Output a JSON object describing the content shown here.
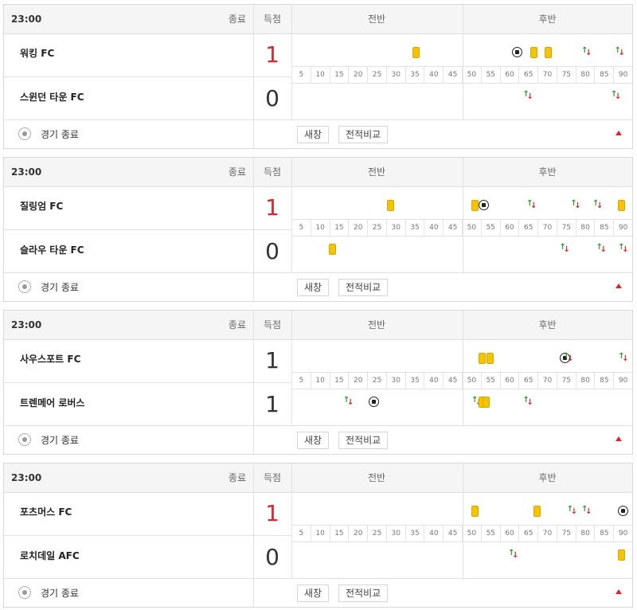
{
  "header": {
    "score_label": "득점",
    "first_half": "전반",
    "second_half": "후반"
  },
  "timeline_ticks": [
    "5",
    "10",
    "15",
    "20",
    "25",
    "30",
    "35",
    "40",
    "45",
    "50",
    "55",
    "60",
    "65",
    "70",
    "75",
    "80",
    "85",
    "90"
  ],
  "colors": {
    "win_score": "#d9262b",
    "yellow_card": "#f5c400",
    "sub_in": "#2a9d2a",
    "sub_out": "#d9262b"
  },
  "footer": {
    "status_text": "경기 종료",
    "refresh_label": "새창",
    "compare_label": "전적비교",
    "status_icon": "soccer-ball-icon"
  },
  "matches": [
    {
      "time": "23:00",
      "status": "종료",
      "home": {
        "name": "워킹 FC",
        "score": "1",
        "winner": true,
        "events": [
          {
            "type": "yellow",
            "minute": 34
          },
          {
            "type": "goal",
            "minute": 61
          },
          {
            "type": "yellow",
            "minute": 66
          },
          {
            "type": "yellow",
            "minute": 70
          },
          {
            "type": "sub",
            "minute": 80
          },
          {
            "type": "sub",
            "minute": 89
          }
        ]
      },
      "away": {
        "name": "스윈던 타운 FC",
        "score": "0",
        "winner": false,
        "events": [
          {
            "type": "sub",
            "minute": 64
          },
          {
            "type": "sub",
            "minute": 88
          }
        ]
      }
    },
    {
      "time": "23:00",
      "status": "종료",
      "home": {
        "name": "질링엄 FC",
        "score": "1",
        "winner": true,
        "events": [
          {
            "type": "yellow",
            "minute": 27
          },
          {
            "type": "yellow",
            "minute": 50
          },
          {
            "type": "goal",
            "minute": 52
          },
          {
            "type": "sub",
            "minute": 65
          },
          {
            "type": "sub",
            "minute": 77
          },
          {
            "type": "sub",
            "minute": 83
          },
          {
            "type": "yellow",
            "minute": 90
          }
        ]
      },
      "away": {
        "name": "슬라우 타운 FC",
        "score": "0",
        "winner": false,
        "events": [
          {
            "type": "yellow",
            "minute": 11
          },
          {
            "type": "sub",
            "minute": 74
          },
          {
            "type": "sub",
            "minute": 84
          },
          {
            "type": "sub",
            "minute": 90
          }
        ]
      }
    },
    {
      "time": "23:00",
      "status": "종료",
      "home": {
        "name": "사우스포트 FC",
        "score": "1",
        "winner": false,
        "events": [
          {
            "type": "yellow",
            "minute": 52
          },
          {
            "type": "yellow",
            "minute": 54
          },
          {
            "type": "goal",
            "minute": 74
          },
          {
            "type": "sub",
            "minute": 75
          },
          {
            "type": "sub",
            "minute": 90
          }
        ]
      },
      "away": {
        "name": "트렌메어 로버스",
        "score": "1",
        "winner": false,
        "events": [
          {
            "type": "sub",
            "minute": 15
          },
          {
            "type": "goal",
            "minute": 22
          },
          {
            "type": "sub",
            "minute": 50
          },
          {
            "type": "yellow",
            "minute": 52
          },
          {
            "type": "yellow",
            "minute": 53
          },
          {
            "type": "sub",
            "minute": 64
          }
        ]
      }
    },
    {
      "time": "23:00",
      "status": "종료",
      "home": {
        "name": "포츠머스 FC",
        "score": "1",
        "winner": true,
        "events": [
          {
            "type": "yellow",
            "minute": 50
          },
          {
            "type": "yellow",
            "minute": 67
          },
          {
            "type": "sub",
            "minute": 76
          },
          {
            "type": "sub",
            "minute": 80
          },
          {
            "type": "goal",
            "minute": 90
          }
        ]
      },
      "away": {
        "name": "로치데일 AFC",
        "score": "0",
        "winner": false,
        "events": [
          {
            "type": "sub",
            "minute": 60
          },
          {
            "type": "yellow",
            "minute": 90
          }
        ]
      }
    }
  ]
}
